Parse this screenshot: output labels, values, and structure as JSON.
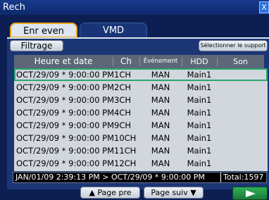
{
  "window": {
    "title": "Rech",
    "close_label": "X"
  },
  "tabs": [
    {
      "label": "Enr even",
      "active": true
    },
    {
      "label": "VMD",
      "active": false
    }
  ],
  "toolbar": {
    "filter_label": "Filtrage",
    "support_label": "Sélectionner le support"
  },
  "table": {
    "columns": [
      "Heure et date",
      "Ch",
      "Événement",
      "HDD",
      "Son"
    ],
    "rows": [
      {
        "date": "OCT/29/09 * 9:00:00 PM",
        "ch": "1CH",
        "event": "MAN",
        "hdd": "Main1",
        "son": ""
      },
      {
        "date": "OCT/29/09 * 9:00:00 PM",
        "ch": "2CH",
        "event": "MAN",
        "hdd": "Main1",
        "son": ""
      },
      {
        "date": "OCT/29/09 * 9:00:00 PM",
        "ch": "3CH",
        "event": "MAN",
        "hdd": "Main1",
        "son": ""
      },
      {
        "date": "OCT/29/09 * 9:00:00 PM",
        "ch": "4CH",
        "event": "MAN",
        "hdd": "Main1",
        "son": ""
      },
      {
        "date": "OCT/29/09 * 9:00:00 PM",
        "ch": "9CH",
        "event": "MAN",
        "hdd": "Main1",
        "son": ""
      },
      {
        "date": "OCT/29/09 * 9:00:00 PM",
        "ch": "10CH",
        "event": "MAN",
        "hdd": "Main1",
        "son": ""
      },
      {
        "date": "OCT/29/09 * 9:00:00 PM",
        "ch": "11CH",
        "event": "MAN",
        "hdd": "Main1",
        "son": ""
      },
      {
        "date": "OCT/29/09 * 9:00:00 PM",
        "ch": "12CH",
        "event": "MAN",
        "hdd": "Main1",
        "son": ""
      }
    ]
  },
  "status": {
    "range": "JAN/01/09  2:39:13 PM > OCT/29/09 * 9:00:00 PM",
    "total": "Total:1597"
  },
  "pager": {
    "prev_label": "▲ Page pre",
    "next_label": "Page suiv ▼",
    "go_icon": "play-arrow-icon"
  },
  "colors": {
    "selection": "#2aa86a",
    "tab_active_border": "#e9a21b",
    "go_button": "#1f8f44"
  }
}
